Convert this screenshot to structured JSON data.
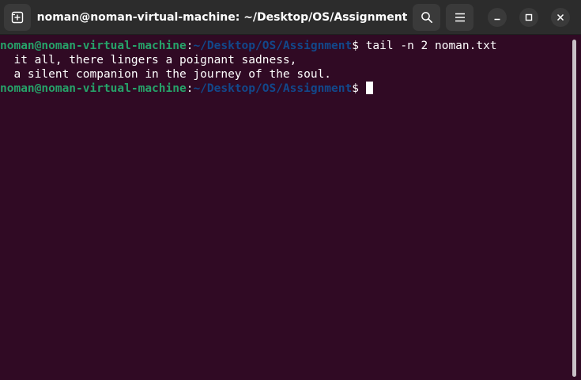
{
  "window": {
    "title": "noman@noman-virtual-machine: ~/Desktop/OS/Assignment"
  },
  "terminal": {
    "prompt_user": "noman@noman-virtual-machine",
    "prompt_colon": ":",
    "prompt_path": "~/Desktop/OS/Assignment",
    "prompt_dollar": "$",
    "command": " tail -n 2 noman.txt",
    "output": [
      "  it all, there lingers a poignant sadness,",
      "  a silent companion in the journey of the soul."
    ]
  },
  "icons": {
    "new_tab": "new-tab-icon",
    "search": "search-icon",
    "menu": "hamburger-menu-icon",
    "minimize": "minimize-icon",
    "maximize": "maximize-icon",
    "close": "close-icon"
  },
  "colors": {
    "background": "#300a24",
    "titlebar": "#2c2c2c",
    "prompt_user": "#26a269",
    "prompt_path": "#12488b",
    "text": "#ffffff"
  }
}
